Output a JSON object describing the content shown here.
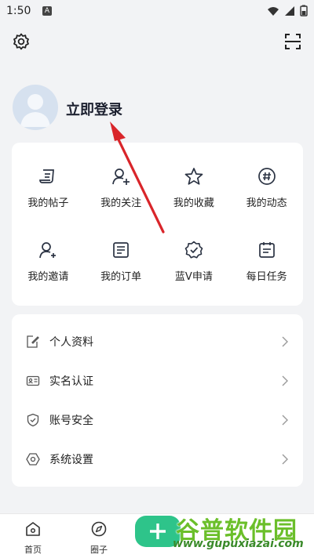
{
  "status": {
    "time": "1:50",
    "notification_icon_letter": "A"
  },
  "profile": {
    "login_label": "立即登录"
  },
  "grid": [
    {
      "label": "我的帖子",
      "icon": "posts-icon"
    },
    {
      "label": "我的关注",
      "icon": "follow-icon"
    },
    {
      "label": "我的收藏",
      "icon": "star-icon"
    },
    {
      "label": "我的动态",
      "icon": "hashtag-icon"
    },
    {
      "label": "我的邀请",
      "icon": "invite-icon"
    },
    {
      "label": "我的订单",
      "icon": "order-icon"
    },
    {
      "label": "蓝V申请",
      "icon": "verify-badge-icon"
    },
    {
      "label": "每日任务",
      "icon": "calendar-icon"
    }
  ],
  "list": [
    {
      "label": "个人资料",
      "icon": "profile-edit-icon"
    },
    {
      "label": "实名认证",
      "icon": "id-card-icon"
    },
    {
      "label": "账号安全",
      "icon": "shield-icon"
    },
    {
      "label": "系统设置",
      "icon": "settings-hex-icon"
    }
  ],
  "nav": {
    "home": "首页",
    "circle": "圈子"
  },
  "watermark": {
    "title": "谷普软件园",
    "url": "www.gupuxiazai.com"
  },
  "colors": {
    "accent": "#2ec48a",
    "arrow": "#d9252a",
    "background": "#f2f3f5"
  }
}
